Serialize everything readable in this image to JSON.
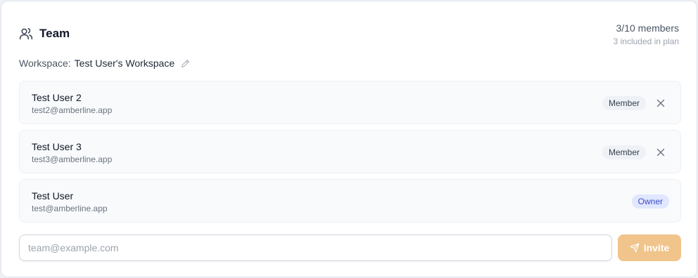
{
  "header": {
    "title": "Team",
    "title_icon": "users-icon",
    "members_count": "3/10 members",
    "members_plan": "3 included in plan"
  },
  "workspace": {
    "label": "Workspace:",
    "name": "Test User's Workspace",
    "edit_icon": "pencil-icon"
  },
  "members": [
    {
      "name": "Test User 2",
      "email": "test2@amberline.app",
      "role": "Member",
      "removable": true
    },
    {
      "name": "Test User 3",
      "email": "test3@amberline.app",
      "role": "Member",
      "removable": true
    },
    {
      "name": "Test User",
      "email": "test@amberline.app",
      "role": "Owner",
      "removable": false
    }
  ],
  "invite": {
    "placeholder": "team@example.com",
    "value": "",
    "button_label": "Invite",
    "button_icon": "send-icon"
  },
  "colors": {
    "accent": "#f0c48b",
    "owner_badge_bg": "#e0e7ff",
    "owner_badge_text": "#3b4bc8",
    "member_badge_bg": "#eef1f5"
  }
}
